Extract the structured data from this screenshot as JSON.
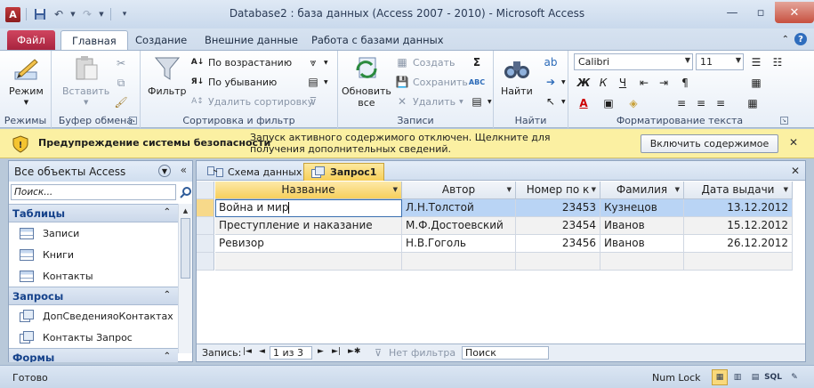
{
  "window": {
    "title": "Database2 : база данных (Access 2007 - 2010)  -  Microsoft Access",
    "app_letter": "A"
  },
  "ribbon_tabs": [
    {
      "label": "Файл"
    },
    {
      "label": "Главная"
    },
    {
      "label": "Создание"
    },
    {
      "label": "Внешние данные"
    },
    {
      "label": "Работа с базами данных"
    }
  ],
  "ribbon": {
    "views": {
      "mode_label": "Режим",
      "group": "Режимы"
    },
    "clipboard": {
      "paste": "Вставить",
      "group": "Буфер обмена"
    },
    "sort": {
      "filter": "Фильтр",
      "asc": "По возрастанию",
      "desc": "По убыванию",
      "remove": "Удалить сортировку",
      "group": "Сортировка и фильтр"
    },
    "records": {
      "refresh": "Обновить\nвсе",
      "refresh_line1": "Обновить",
      "refresh_line2": "все",
      "create": "Создать",
      "save": "Сохранить",
      "delete": "Удалить",
      "group": "Записи"
    },
    "find": {
      "find": "Найти",
      "group": "Найти"
    },
    "format": {
      "font": "Calibri",
      "size": "11",
      "group": "Форматирование текста"
    }
  },
  "security": {
    "title": "Предупреждение системы безопасности",
    "message": "Запуск активного содержимого отключен. Щелкните для получения дополнительных сведений.",
    "button": "Включить содержимое"
  },
  "nav": {
    "header": "Все объекты Access",
    "search_placeholder": "Поиск...",
    "groups": [
      {
        "label": "Таблицы",
        "items": [
          "Записи",
          "Книги",
          "Контакты"
        ]
      },
      {
        "label": "Запросы",
        "items": [
          "ДопСведенияоКонтактах",
          "Контакты Запрос"
        ]
      },
      {
        "label": "Формы",
        "items": []
      }
    ]
  },
  "doc": {
    "tabs": [
      "Схема данных",
      "Запрос1"
    ],
    "columns": [
      "Название",
      "Автор",
      "Номер по к",
      "Фамилия",
      "Дата выдачи"
    ],
    "rows": [
      [
        "Война и мир",
        "Л.Н.Толстой",
        "23453",
        "Кузнецов",
        "13.12.2012"
      ],
      [
        "Преступление и наказание",
        "М.Ф.Достоевский",
        "23454",
        "Иванов",
        "15.12.2012"
      ],
      [
        "Ревизор",
        "Н.В.Гоголь",
        "23456",
        "Иванов",
        "26.12.2012"
      ]
    ]
  },
  "recnav": {
    "label": "Запись:",
    "position": "1 из 3",
    "filter": "Нет фильтра",
    "search": "Поиск"
  },
  "status": {
    "ready": "Готово",
    "num_lock": "Num Lock",
    "sql": "SQL"
  },
  "colors": {
    "file_tab": "#b8294a",
    "security_bar": "#fbf0a2",
    "selected_row": "#b9d4f5",
    "active_tab": "#f7cf57"
  }
}
